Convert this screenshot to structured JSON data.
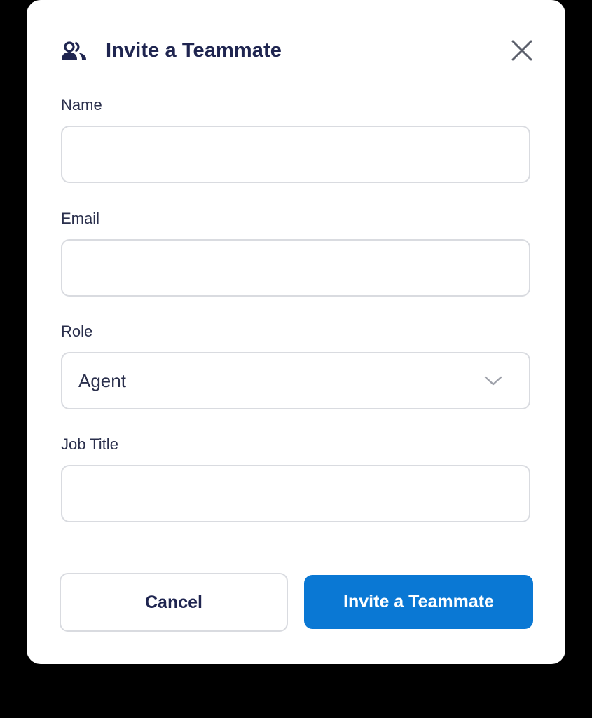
{
  "dialog": {
    "title": "Invite a Teammate",
    "icon": "team-icon",
    "close_icon": "close-icon"
  },
  "fields": {
    "name": {
      "label": "Name",
      "value": ""
    },
    "email": {
      "label": "Email",
      "value": ""
    },
    "role": {
      "label": "Role",
      "value": "Agent",
      "icon": "chevron-down-icon"
    },
    "job_title": {
      "label": "Job Title",
      "value": ""
    }
  },
  "actions": {
    "cancel_label": "Cancel",
    "invite_label": "Invite a Teammate"
  },
  "colors": {
    "primary": "#0a78d4",
    "title_text": "#1f2550",
    "border": "#d9dbe0",
    "background": "#000000",
    "modal": "#ffffff"
  }
}
